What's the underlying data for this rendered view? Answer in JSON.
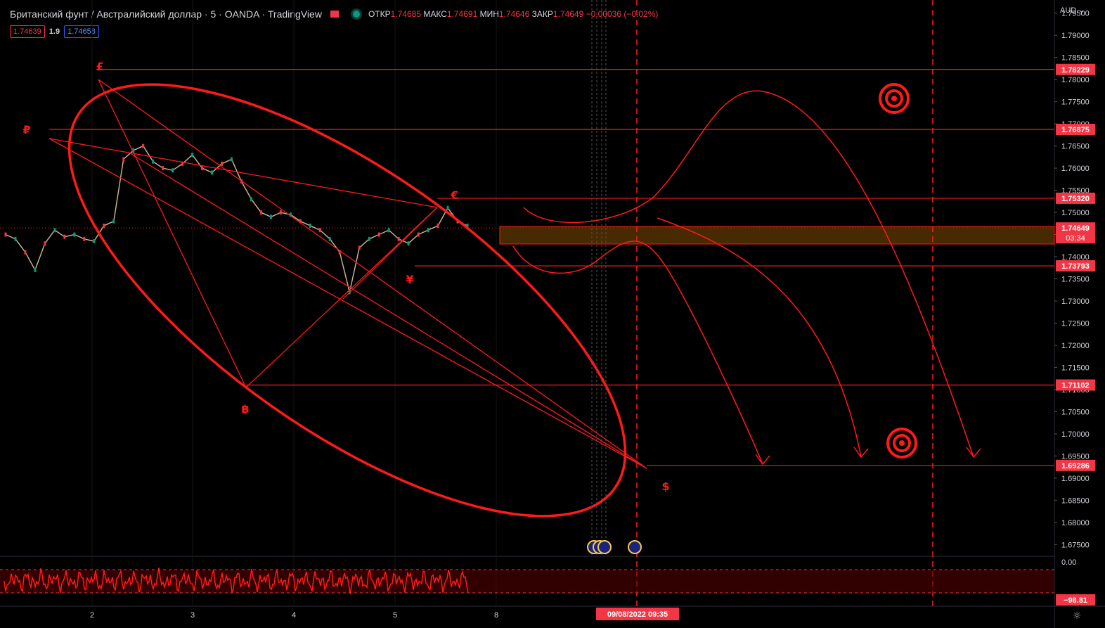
{
  "header": {
    "title": "Британский фунт / Австралийский доллар · 5 · OANDA · TradingView",
    "open_label": "ОТКР",
    "open": "1.74685",
    "high_label": "МАКС",
    "high": "1.74691",
    "low_label": "МИН",
    "low": "1.74646",
    "close_label": "ЗАКР",
    "close": "1.74649",
    "change": "−0.00036 (−0.02%)"
  },
  "badges": {
    "sell": "1.74639",
    "spread": "1.9",
    "buy": "1.74658"
  },
  "axis": {
    "currency": "AUD",
    "ticks": [
      "1.79500",
      "1.79000",
      "1.78500",
      "1.78000",
      "1.77500",
      "1.77000",
      "1.76500",
      "1.76000",
      "1.75500",
      "1.75000",
      "1.74500",
      "1.74000",
      "1.73500",
      "1.73000",
      "1.72500",
      "1.72000",
      "1.71500",
      "1.71000",
      "1.70500",
      "1.70000",
      "1.69500",
      "1.69000",
      "1.68500",
      "1.68000",
      "1.67500"
    ],
    "x_ticks": [
      "2",
      "3",
      "4",
      "5",
      "8"
    ],
    "date_label": "09/08/2022   09:35",
    "osc_top": "0.00",
    "osc_bottom": "−98.81"
  },
  "levels": [
    {
      "price": "1.78229"
    },
    {
      "price": "1.76875"
    },
    {
      "price": "1.75320"
    },
    {
      "price": "1.74649",
      "extra": "03:34"
    },
    {
      "price": "1.73793"
    },
    {
      "price": "1.71102"
    },
    {
      "price": "1.69286"
    }
  ],
  "symbols": [
    "£",
    "₽",
    "€",
    "¥",
    "฿",
    "$"
  ],
  "colors": {
    "accent": "#f23645",
    "drawing": "#ff1a1a",
    "background": "#000000",
    "text": "#d1d4dc"
  },
  "chart_data": {
    "type": "line",
    "title": "Британский фунт / Австралийский доллар · 5 · OANDA · TradingView",
    "x_ticks": [
      "2",
      "3",
      "4",
      "5",
      "8"
    ],
    "ylim": [
      1.6725,
      1.7975
    ],
    "y_ticks": [
      1.795,
      1.79,
      1.785,
      1.78,
      1.775,
      1.77,
      1.765,
      1.76,
      1.755,
      1.75,
      1.745,
      1.74,
      1.735,
      1.73,
      1.725,
      1.72,
      1.715,
      1.71,
      1.705,
      1.7,
      1.695,
      1.69,
      1.685,
      1.68,
      1.675
    ],
    "series": [
      {
        "values": [
          1.745,
          1.744,
          1.741,
          1.737,
          1.743,
          1.746,
          1.7445,
          1.745,
          1.744,
          1.7435,
          1.747,
          1.748,
          1.762,
          1.764,
          1.765,
          1.7615,
          1.76,
          1.7595,
          1.761,
          1.763,
          1.76,
          1.759,
          1.761,
          1.762,
          1.757,
          1.753,
          1.75,
          1.749,
          1.75,
          1.7495,
          1.748,
          1.747,
          1.746,
          1.744,
          1.741,
          1.732,
          1.742,
          1.744,
          1.745,
          1.746,
          1.744,
          1.743,
          1.745,
          1.746,
          1.747,
          1.751,
          1.748,
          1.747
        ]
      }
    ]
  }
}
